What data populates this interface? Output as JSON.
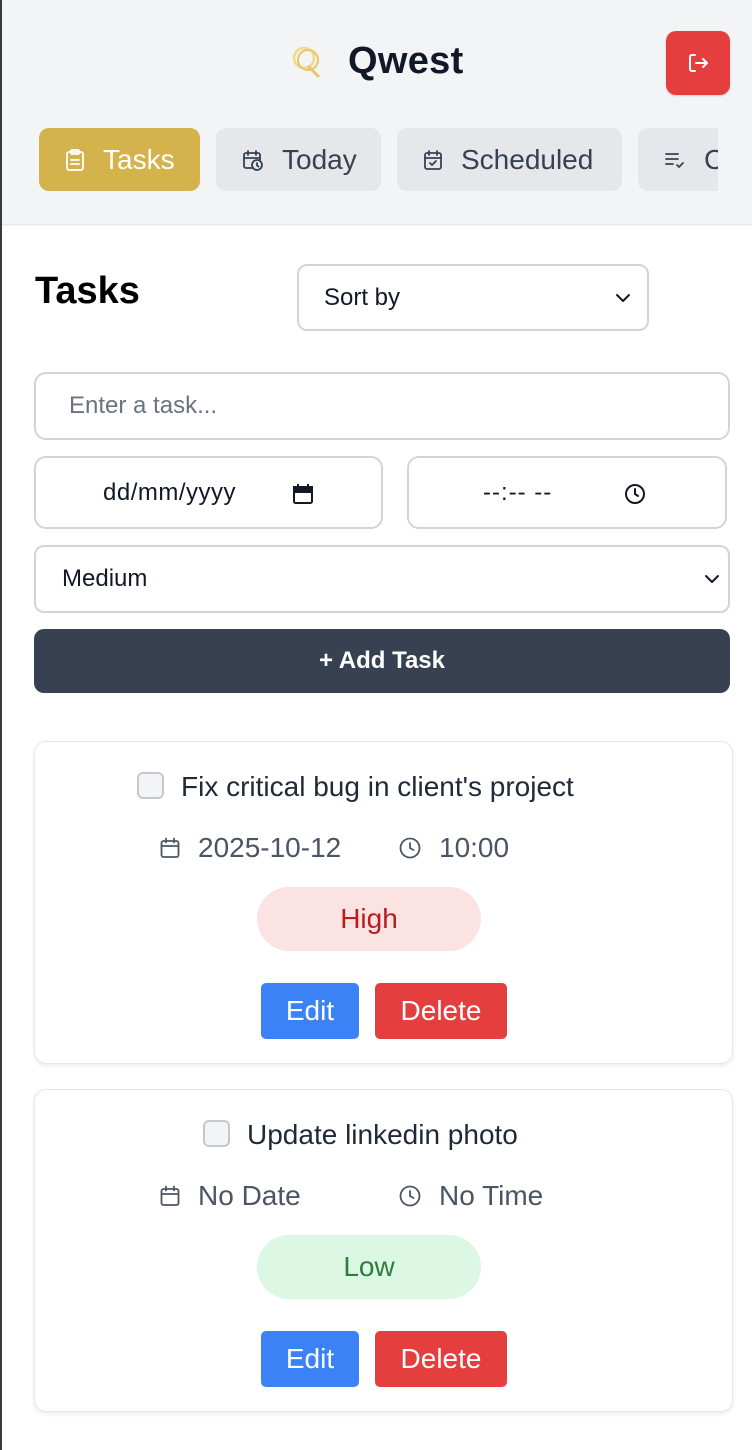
{
  "app": {
    "title": "Qwest",
    "brand_color": "#d4b24c"
  },
  "header": {
    "logout_icon": "logout-icon"
  },
  "tabs": [
    {
      "label": "Tasks",
      "icon": "clipboard-icon",
      "active": true
    },
    {
      "label": "Today",
      "icon": "calendar-clock-icon",
      "active": false
    },
    {
      "label": "Scheduled",
      "icon": "calendar-check-icon",
      "active": false
    },
    {
      "label": "Completed",
      "icon": "list-check-icon",
      "active": false
    }
  ],
  "main": {
    "title": "Tasks",
    "sort_select": {
      "value": "Sort by"
    },
    "task_input": {
      "placeholder": "Enter a task...",
      "value": ""
    },
    "date_input": {
      "value": "dd/mm/yyyy"
    },
    "time_input": {
      "value": "--:-- --"
    },
    "priority_select": {
      "value": "Medium"
    },
    "add_button": "+ Add Task"
  },
  "tasks": [
    {
      "title": "Fix critical bug in client's project",
      "checked": false,
      "date": "2025-10-12",
      "time": "10:00",
      "priority": "High",
      "edit_label": "Edit",
      "delete_label": "Delete"
    },
    {
      "title": "Update linkedin photo",
      "checked": false,
      "date": "No Date",
      "time": "No Time",
      "priority": "Low",
      "edit_label": "Edit",
      "delete_label": "Delete"
    }
  ],
  "colors": {
    "accent": "#d4b24c",
    "danger": "#e53e3e",
    "primary": "#3b82f6",
    "dark": "#374151",
    "high_badge_bg": "#fbe3e3",
    "low_badge_bg": "#dcf7e3"
  }
}
